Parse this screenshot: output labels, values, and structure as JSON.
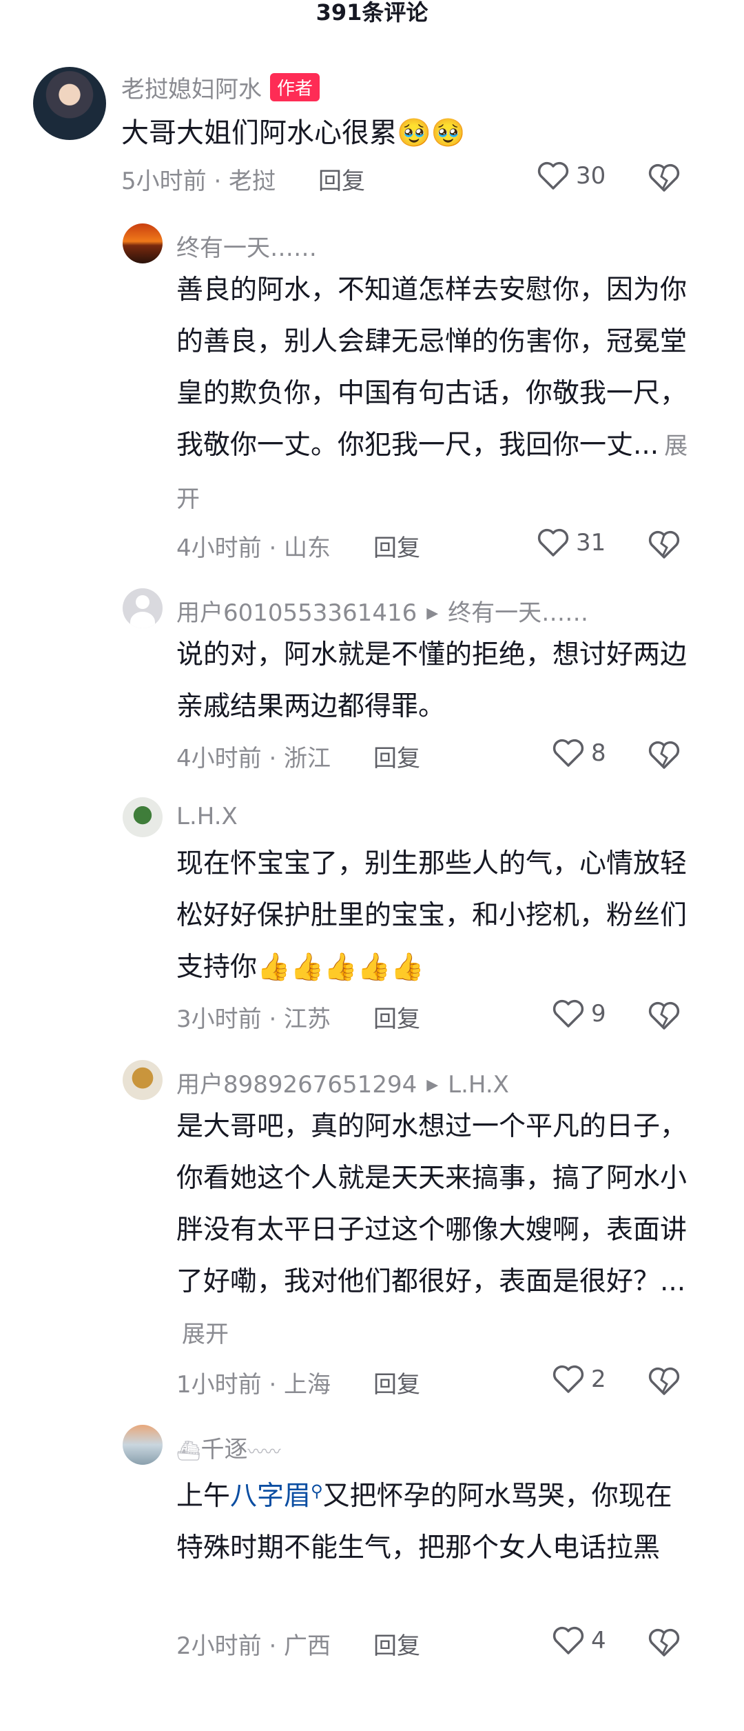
{
  "header": {
    "title": "391条评论"
  },
  "comments": [
    {
      "user": "老挝媳妇阿水",
      "badge": "作者",
      "text": "大哥大姐们阿水心很累🥹🥹",
      "time": "5小时前 · 老挝",
      "reply": "回复",
      "likes": "30"
    },
    {
      "user": "终有一天……",
      "text": "善良的阿水，不知道怎样去安慰你，因为你的善良，别人会肆无忌惮的伤害你，冠冕堂皇的欺负你，中国有句古话，你敬我一尺，我敬你一丈。你犯我一尺，我回你一丈...",
      "expand": "展开",
      "time": "4小时前 · 山东",
      "reply": "回复",
      "likes": "31"
    },
    {
      "user": "用户6010553361416",
      "reply_to": "终有一天……",
      "text": "说的对，阿水就是不懂的拒绝，想讨好两边亲戚结果两边都得罪。",
      "time": "4小时前 · 浙江",
      "reply": "回复",
      "likes": "8"
    },
    {
      "user": "L.H.X",
      "text": "现在怀宝宝了，别生那些人的气，心情放轻松好好保护肚里的宝宝，和小挖机，粉丝们支持你👍👍👍👍👍",
      "time": "3小时前 · 江苏",
      "reply": "回复",
      "likes": "9"
    },
    {
      "user": "用户8989267651294",
      "reply_to": "L.H.X",
      "text": "是大哥吧，真的阿水想过一个平凡的日子，你看她这个人就是天天来搞事，搞了阿水小胖没有太平日子过这个哪像大嫂啊，表面讲了好嘞，我对他们都很好，表面是很好？...",
      "expand": "展开",
      "time": "1小时前 · 上海",
      "reply": "回复",
      "likes": "2"
    },
    {
      "user": "千逐",
      "text_before": "上午",
      "mention": "八字眉",
      "text_after": "又把怀孕的阿水骂哭，你现在特殊时期不能生气，把那个女人电话拉黑",
      "time": "2小时前 · 广西",
      "reply": "回复",
      "likes": "4"
    }
  ],
  "icons": {
    "like": "heart-outline-icon",
    "dislike": "broken-heart-icon",
    "reply_arrow": "play-triangle-icon",
    "search": "search-icon"
  }
}
